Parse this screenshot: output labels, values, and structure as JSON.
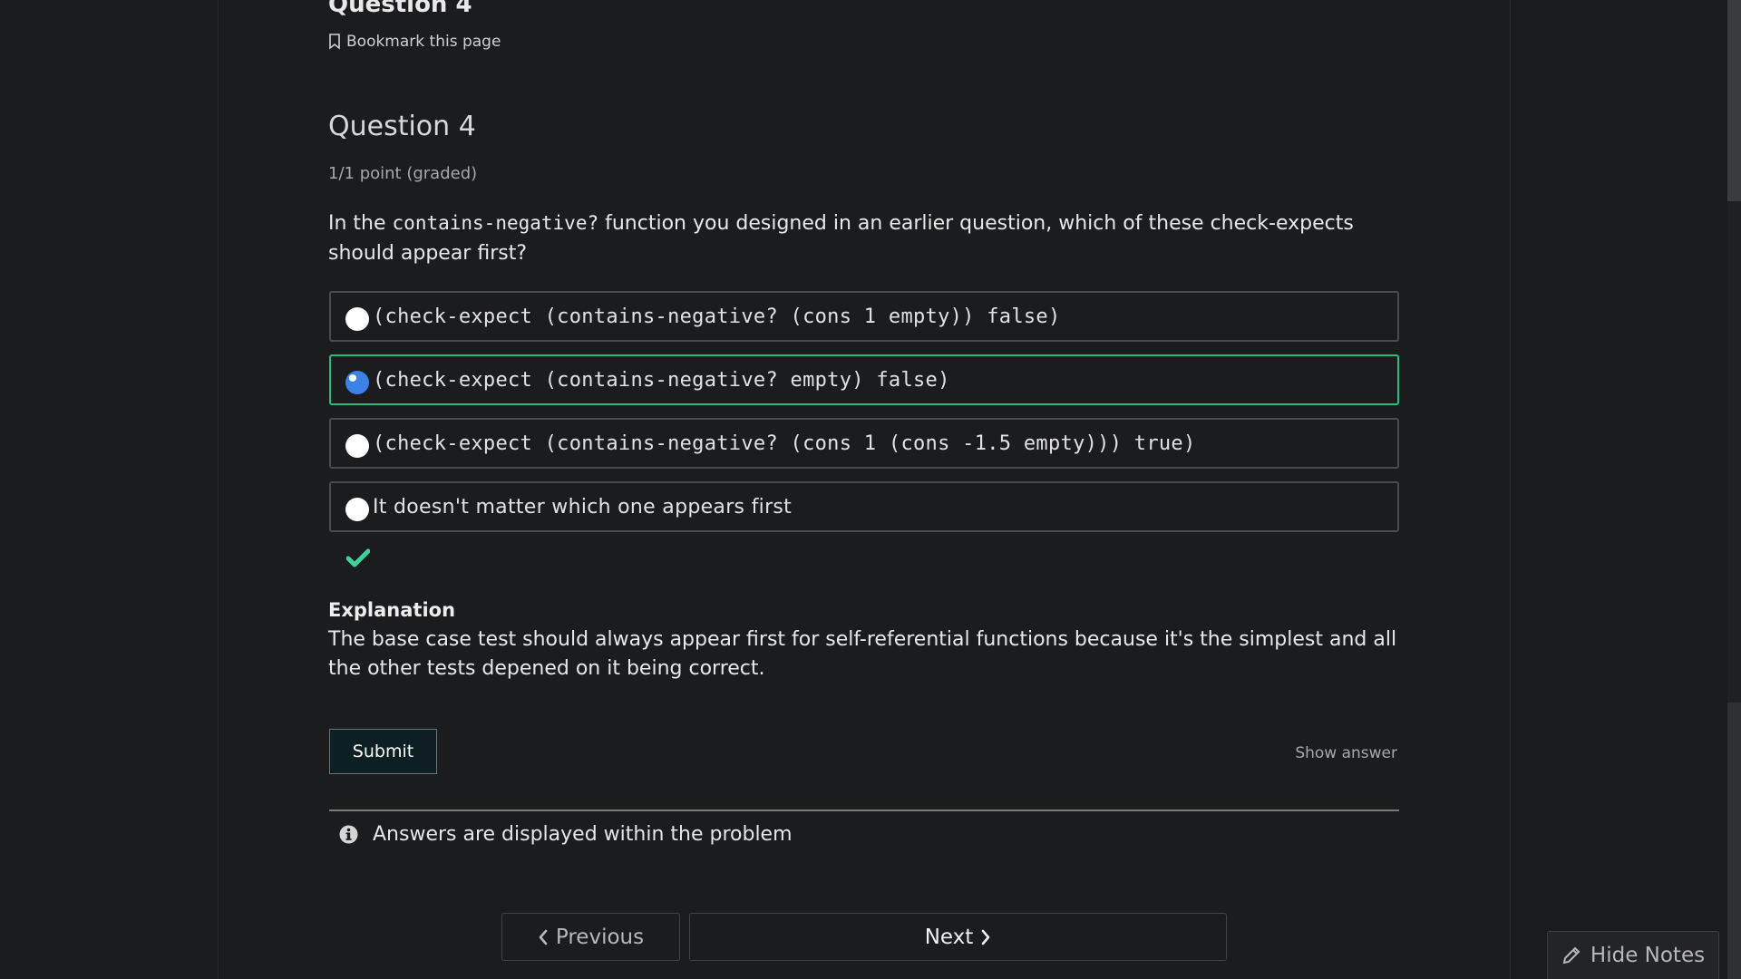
{
  "unit": {
    "title": "Question 4",
    "bookmark_label": "Bookmark this page"
  },
  "problem": {
    "title": "Question 4",
    "points": "1/1 point (graded)",
    "prompt_before": "In the ",
    "prompt_code": "contains-negative?",
    "prompt_after": " function you designed in an earlier question, which of these check-expects should appear first?",
    "options": [
      {
        "label": "(check-expect (contains-negative? (cons 1 empty)) false)",
        "selected": false
      },
      {
        "label": "(check-expect (contains-negative? empty) false)",
        "selected": true
      },
      {
        "label": "(check-expect (contains-negative? (cons 1 (cons -1.5 empty))) true)",
        "selected": false
      },
      {
        "label": "It doesn't matter which one appears first",
        "selected": false
      }
    ],
    "status_icon": "checkmark-icon",
    "status_color": "#3ad49a",
    "selected_border_color": "#1fbf7d"
  },
  "explanation": {
    "title": "Explanation",
    "text": "The base case test should always appear first for self-referential functions because it's the simplest and all the other tests depened on it being correct."
  },
  "actions": {
    "submit_label": "Submit",
    "show_answer_label": "Show answer"
  },
  "notice": {
    "text": "Answers are displayed within the problem",
    "icon": "info-icon"
  },
  "navigation": {
    "previous_label": "Previous",
    "next_label": "Next"
  },
  "notes": {
    "hide_label": "Hide Notes",
    "icon": "pencil-icon"
  }
}
